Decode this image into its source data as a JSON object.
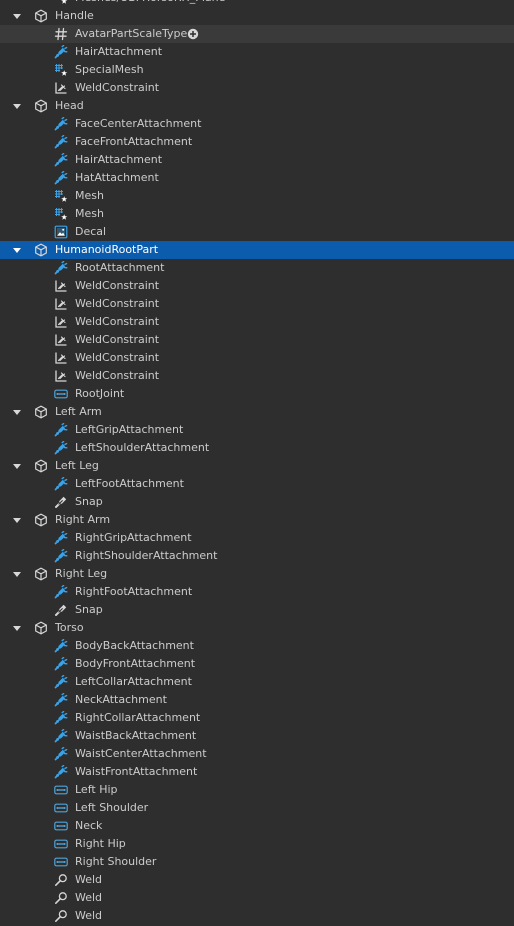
{
  "explorer": {
    "items": [
      {
        "depth": 1,
        "icon": "special-mesh-icon",
        "label": "Meshes/UBMTorsoRH_Plane"
      },
      {
        "depth": 0,
        "icon": "part-cube-icon",
        "label": "Handle",
        "expanded": true
      },
      {
        "depth": 1,
        "icon": "value-hash-icon",
        "label": "AvatarPartScaleType",
        "hovered": true,
        "addButton": true
      },
      {
        "depth": 1,
        "icon": "attachment-icon",
        "label": "HairAttachment"
      },
      {
        "depth": 1,
        "icon": "special-mesh-icon",
        "label": "SpecialMesh"
      },
      {
        "depth": 1,
        "icon": "weld-constraint-icon",
        "label": "WeldConstraint"
      },
      {
        "depth": 0,
        "icon": "part-cube-icon",
        "label": "Head",
        "expanded": true
      },
      {
        "depth": 1,
        "icon": "attachment-icon",
        "label": "FaceCenterAttachment"
      },
      {
        "depth": 1,
        "icon": "attachment-icon",
        "label": "FaceFrontAttachment"
      },
      {
        "depth": 1,
        "icon": "attachment-icon",
        "label": "HairAttachment"
      },
      {
        "depth": 1,
        "icon": "attachment-icon",
        "label": "HatAttachment"
      },
      {
        "depth": 1,
        "icon": "special-mesh-icon",
        "label": "Mesh"
      },
      {
        "depth": 1,
        "icon": "special-mesh-icon",
        "label": "Mesh"
      },
      {
        "depth": 1,
        "icon": "decal-icon",
        "label": "Decal"
      },
      {
        "depth": 0,
        "icon": "part-cube-icon",
        "label": "HumanoidRootPart",
        "expanded": true,
        "selected": true
      },
      {
        "depth": 1,
        "icon": "attachment-icon",
        "label": "RootAttachment"
      },
      {
        "depth": 1,
        "icon": "weld-constraint-icon",
        "label": "WeldConstraint"
      },
      {
        "depth": 1,
        "icon": "weld-constraint-icon",
        "label": "WeldConstraint"
      },
      {
        "depth": 1,
        "icon": "weld-constraint-icon",
        "label": "WeldConstraint"
      },
      {
        "depth": 1,
        "icon": "weld-constraint-icon",
        "label": "WeldConstraint"
      },
      {
        "depth": 1,
        "icon": "weld-constraint-icon",
        "label": "WeldConstraint"
      },
      {
        "depth": 1,
        "icon": "weld-constraint-icon",
        "label": "WeldConstraint"
      },
      {
        "depth": 1,
        "icon": "motor6d-icon",
        "label": "RootJoint"
      },
      {
        "depth": 0,
        "icon": "part-cube-icon",
        "label": "Left Arm",
        "expanded": true
      },
      {
        "depth": 1,
        "icon": "attachment-icon",
        "label": "LeftGripAttachment"
      },
      {
        "depth": 1,
        "icon": "attachment-icon",
        "label": "LeftShoulderAttachment"
      },
      {
        "depth": 0,
        "icon": "part-cube-icon",
        "label": "Left Leg",
        "expanded": true
      },
      {
        "depth": 1,
        "icon": "attachment-icon",
        "label": "LeftFootAttachment"
      },
      {
        "depth": 1,
        "icon": "snap-icon",
        "label": "Snap"
      },
      {
        "depth": 0,
        "icon": "part-cube-icon",
        "label": "Right Arm",
        "expanded": true
      },
      {
        "depth": 1,
        "icon": "attachment-icon",
        "label": "RightGripAttachment"
      },
      {
        "depth": 1,
        "icon": "attachment-icon",
        "label": "RightShoulderAttachment"
      },
      {
        "depth": 0,
        "icon": "part-cube-icon",
        "label": "Right Leg",
        "expanded": true
      },
      {
        "depth": 1,
        "icon": "attachment-icon",
        "label": "RightFootAttachment"
      },
      {
        "depth": 1,
        "icon": "snap-icon",
        "label": "Snap"
      },
      {
        "depth": 0,
        "icon": "part-cube-icon",
        "label": "Torso",
        "expanded": true
      },
      {
        "depth": 1,
        "icon": "attachment-icon",
        "label": "BodyBackAttachment"
      },
      {
        "depth": 1,
        "icon": "attachment-icon",
        "label": "BodyFrontAttachment"
      },
      {
        "depth": 1,
        "icon": "attachment-icon",
        "label": "LeftCollarAttachment"
      },
      {
        "depth": 1,
        "icon": "attachment-icon",
        "label": "NeckAttachment"
      },
      {
        "depth": 1,
        "icon": "attachment-icon",
        "label": "RightCollarAttachment"
      },
      {
        "depth": 1,
        "icon": "attachment-icon",
        "label": "WaistBackAttachment"
      },
      {
        "depth": 1,
        "icon": "attachment-icon",
        "label": "WaistCenterAttachment"
      },
      {
        "depth": 1,
        "icon": "attachment-icon",
        "label": "WaistFrontAttachment"
      },
      {
        "depth": 1,
        "icon": "motor6d-icon",
        "label": "Left Hip"
      },
      {
        "depth": 1,
        "icon": "motor6d-icon",
        "label": "Left Shoulder"
      },
      {
        "depth": 1,
        "icon": "motor6d-icon",
        "label": "Neck"
      },
      {
        "depth": 1,
        "icon": "motor6d-icon",
        "label": "Right Hip"
      },
      {
        "depth": 1,
        "icon": "motor6d-icon",
        "label": "Right Shoulder"
      },
      {
        "depth": 1,
        "icon": "weld-icon",
        "label": "Weld"
      },
      {
        "depth": 1,
        "icon": "weld-icon",
        "label": "Weld"
      },
      {
        "depth": 1,
        "icon": "weld-icon",
        "label": "Weld"
      }
    ]
  },
  "colors": {
    "background": "#2e2e2e",
    "hover": "#3a3a3a",
    "selected": "#0b5cad",
    "text": "#cccccc",
    "attachment": "#3aa3e8",
    "motor6d": "#4fa3d9"
  }
}
